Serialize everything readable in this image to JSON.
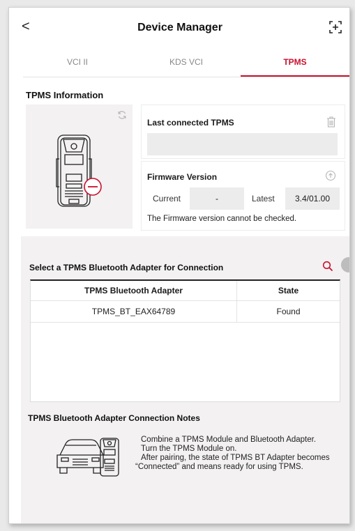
{
  "header": {
    "back_label": "<",
    "title": "Device Manager"
  },
  "tabs": [
    {
      "label": "VCI II",
      "active": false
    },
    {
      "label": "KDS VCI",
      "active": false
    },
    {
      "label": "TPMS",
      "active": true
    }
  ],
  "tpms_info": {
    "section_title": "TPMS Information",
    "last_connected_label": "Last connected TPMS",
    "last_connected_value": "",
    "firmware_label": "Firmware Version",
    "current_label": "Current",
    "current_value": "-",
    "latest_label": "Latest",
    "latest_value": "3.4/01.00",
    "firmware_message": "The Firmware version cannot be checked."
  },
  "adapter_select": {
    "title": "Select a TPMS Bluetooth Adapter for Connection",
    "columns": [
      "TPMS Bluetooth Adapter",
      "State"
    ],
    "rows": [
      {
        "adapter": "TPMS_BT_EAX64789",
        "state": "Found"
      }
    ]
  },
  "notes": {
    "title": "TPMS Bluetooth Adapter Connection Notes",
    "lines": [
      "Combine a TPMS Module and Bluetooth Adapter.",
      "Turn the TPMS Module on.",
      "After pairing, the state of TPMS BT Adapter becomes “Connected” and means ready for using TPMS."
    ]
  },
  "colors": {
    "accent": "#c8102e",
    "panel_bg": "#f3f1f1",
    "field_bg": "#ececec"
  },
  "icons": [
    "back-icon",
    "expand-icon",
    "refresh-icon",
    "trash-icon",
    "firmware-update-icon",
    "search-icon",
    "tpms-device-icon",
    "car-adapter-icon"
  ]
}
